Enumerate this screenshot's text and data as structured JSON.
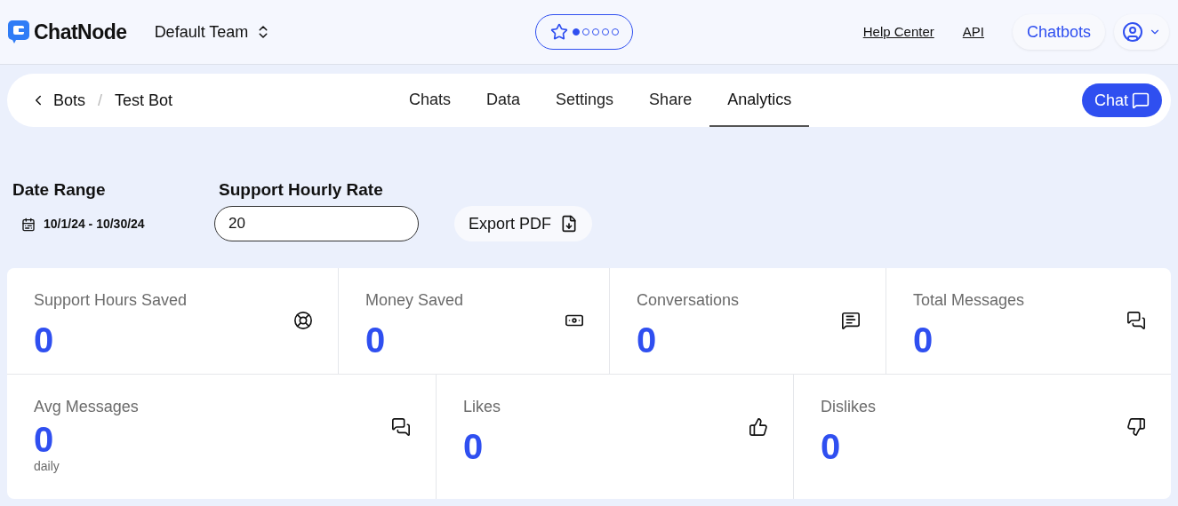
{
  "header": {
    "brand": "ChatNode",
    "team": "Default Team",
    "progress_dots": [
      {
        "filled": true
      },
      {
        "filled": false
      },
      {
        "filled": false
      },
      {
        "filled": false
      },
      {
        "filled": false
      }
    ],
    "links": [
      "Help Center",
      "API"
    ],
    "chatbots_button": "Chatbots"
  },
  "nav": {
    "breadcrumb": [
      "Bots",
      "Test Bot"
    ],
    "separator": "/",
    "tabs": [
      {
        "label": "Chats",
        "selected": false
      },
      {
        "label": "Data",
        "selected": false
      },
      {
        "label": "Settings",
        "selected": false
      },
      {
        "label": "Share",
        "selected": false
      },
      {
        "label": "Analytics",
        "selected": true
      }
    ],
    "chat_button": "Chat"
  },
  "filters": {
    "date_range_label": "Date Range",
    "date_range": "10/1/24 - 10/30/24",
    "rate_label": "Support Hourly Rate",
    "rate_value": "20",
    "export_button": "Export PDF"
  },
  "stats_row_1": [
    {
      "label": "Support Hours Saved",
      "value": "0"
    },
    {
      "label": "Money Saved",
      "value": "0"
    },
    {
      "label": "Conversations",
      "value": "0"
    },
    {
      "label": "Total Messages",
      "value": "0"
    }
  ],
  "stats_row_2": [
    {
      "label": "Avg Messages",
      "value": "0",
      "note": "daily"
    },
    {
      "label": "Likes",
      "value": "0"
    },
    {
      "label": "Dislikes",
      "value": "0"
    }
  ]
}
